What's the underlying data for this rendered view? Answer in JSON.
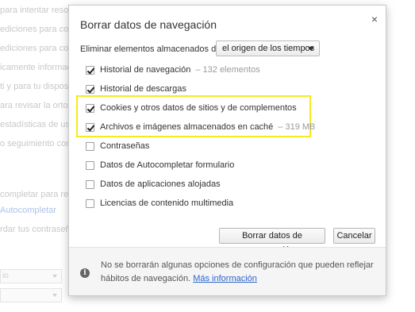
{
  "background": {
    "lines": [
      "para intentar resolver errores de navegación",
      "ediciones para completar",
      "ediciones para completar búsquedas",
      "icamente información",
      "ti y para tu dispositivo",
      "ara revisar la ortografía",
      "estadísticas de uso e",
      "o seguimiento con tu",
      "completar para rellenar",
      "Autocompletar",
      "rdar tus contraseñas"
    ],
    "select_1": "io",
    "select_2": ""
  },
  "dialog": {
    "title": "Borrar datos de navegación",
    "close_glyph": "×",
    "range_label": "Eliminar elementos almacenados desde:",
    "range_value": "el origen de los tiempos",
    "options": [
      {
        "label": "Historial de navegación",
        "count": "– 132 elementos",
        "checked": true
      },
      {
        "label": "Historial de descargas",
        "count": "",
        "checked": true
      },
      {
        "label": "Cookies y otros datos de sitios y de complementos",
        "count": "",
        "checked": true
      },
      {
        "label": "Archivos e imágenes almacenados en caché",
        "count": "– 319 MB",
        "checked": true
      },
      {
        "label": "Contraseñas",
        "count": "",
        "checked": false
      },
      {
        "label": "Datos de Autocompletar formulario",
        "count": "",
        "checked": false
      },
      {
        "label": "Datos de aplicaciones alojadas",
        "count": "",
        "checked": false
      },
      {
        "label": "Licencias de contenido multimedia",
        "count": "",
        "checked": false
      }
    ],
    "clear_button": "Borrar datos de navegación",
    "cancel_button": "Cancelar",
    "footer_text": "No se borrarán algunas opciones de configuración que pueden reflejar hábitos de navegación.",
    "footer_link": "Más información",
    "info_glyph": "i",
    "highlight_color": "#f5eb1f"
  }
}
